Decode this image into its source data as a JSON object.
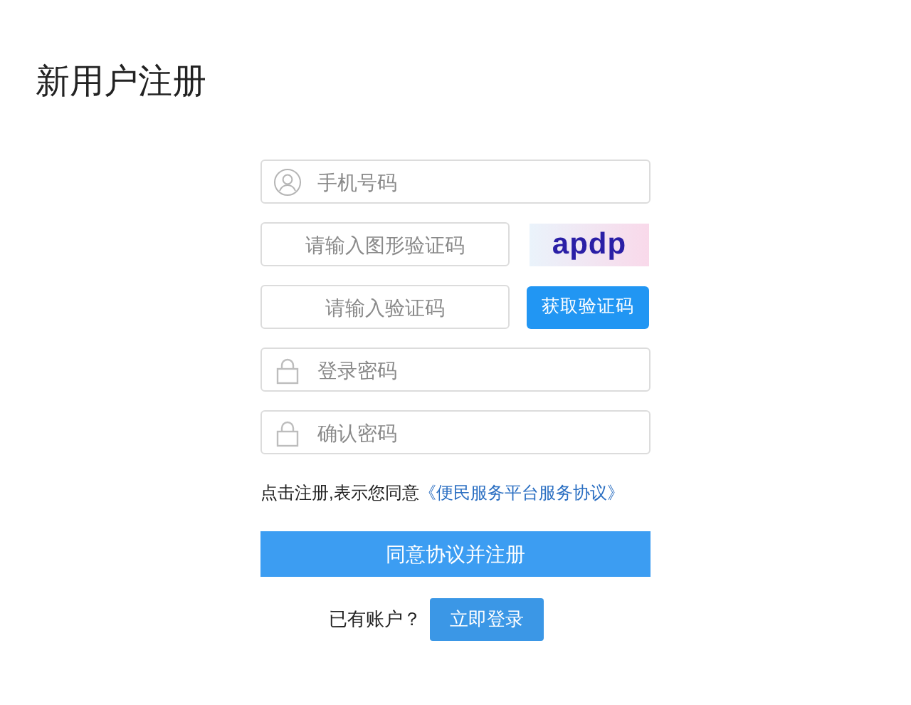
{
  "title": "新用户注册",
  "fields": [
    {
      "placeholder": "手机号码",
      "kind": "phone"
    },
    {
      "placeholder": "请输入图形验证码",
      "addon": {
        "kind": "captcha",
        "text": "apdp"
      }
    },
    {
      "placeholder": "请输入验证码",
      "addon": {
        "kind": "button",
        "label": "获取验证码"
      }
    },
    {
      "placeholder": "登录密码",
      "kind": "password"
    },
    {
      "placeholder": "确认密码",
      "kind": "password"
    }
  ],
  "agreement": {
    "text": "点击注册,表示您同意",
    "link": "《便民服务平台服务协议》"
  },
  "submit": "同意协议并注册",
  "login": {
    "prompt": "已有账户？",
    "button": "立即登录"
  }
}
